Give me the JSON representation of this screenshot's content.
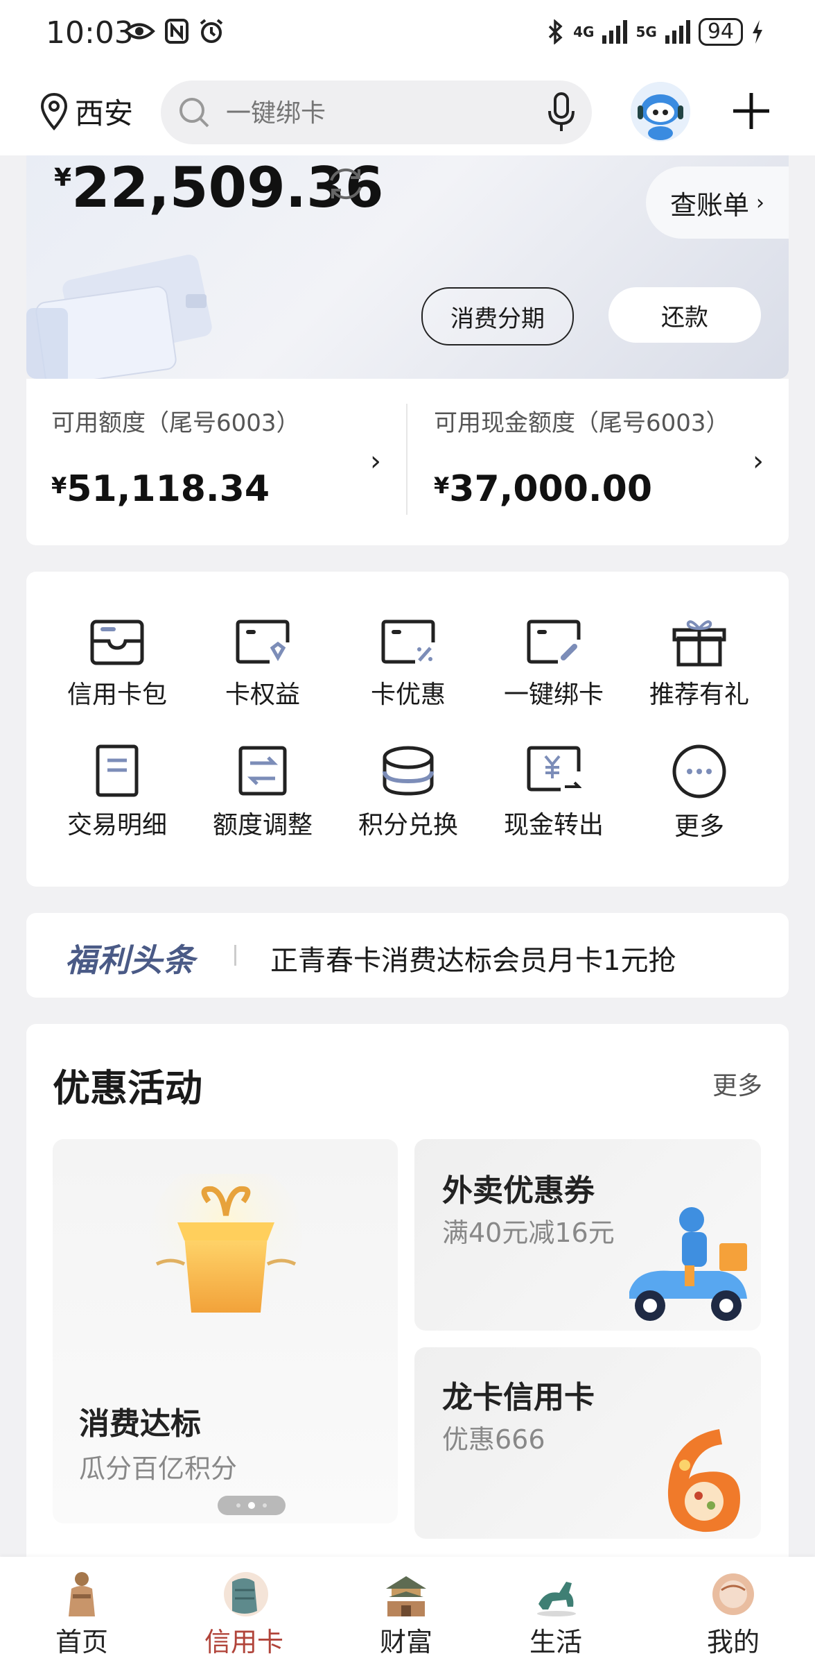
{
  "status_bar": {
    "time": "10:03",
    "battery": "94",
    "network1": "4G",
    "network2": "5G"
  },
  "header": {
    "location": "西安",
    "search_placeholder": "一键绑卡"
  },
  "card": {
    "balance_symbol": "¥",
    "balance": "22,509.36",
    "bill_button": "查账单",
    "installment_button": "消费分期",
    "repay_button": "还款"
  },
  "limits": {
    "available_label": "可用额度（尾号6003）",
    "available_symbol": "¥",
    "available_value": "51,118.34",
    "cash_label": "可用现金额度（尾号6003）",
    "cash_symbol": "¥",
    "cash_value": "37,000.00"
  },
  "services": [
    {
      "label": "信用卡包",
      "icon": "card-wallet-icon"
    },
    {
      "label": "卡权益",
      "icon": "card-benefit-icon"
    },
    {
      "label": "卡优惠",
      "icon": "card-discount-icon"
    },
    {
      "label": "一键绑卡",
      "icon": "card-link-icon"
    },
    {
      "label": "推荐有礼",
      "icon": "gift-icon"
    },
    {
      "label": "交易明细",
      "icon": "transaction-icon"
    },
    {
      "label": "额度调整",
      "icon": "limit-adjust-icon"
    },
    {
      "label": "积分兑换",
      "icon": "points-icon"
    },
    {
      "label": "现金转出",
      "icon": "cash-out-icon"
    },
    {
      "label": "更多",
      "icon": "more-icon"
    }
  ],
  "notice": {
    "tag": "福利头条",
    "text": "正青春卡消费达标会员月卡1元抢"
  },
  "promotions": {
    "title": "优惠活动",
    "more": "更多",
    "big": {
      "title": "消费达标",
      "subtitle": "瓜分百亿积分"
    },
    "small1": {
      "title": "外卖优惠券",
      "subtitle": "满40元减16元"
    },
    "small2": {
      "title": "龙卡信用卡",
      "subtitle": "优惠666"
    }
  },
  "nav": [
    {
      "label": "首页",
      "active": false
    },
    {
      "label": "信用卡",
      "active": true
    },
    {
      "label": "财富",
      "active": false
    },
    {
      "label": "生活",
      "active": false
    },
    {
      "label": "我的",
      "active": false
    }
  ],
  "colors": {
    "accent": "#b1443a",
    "notice_tag": "#4a5a86"
  }
}
